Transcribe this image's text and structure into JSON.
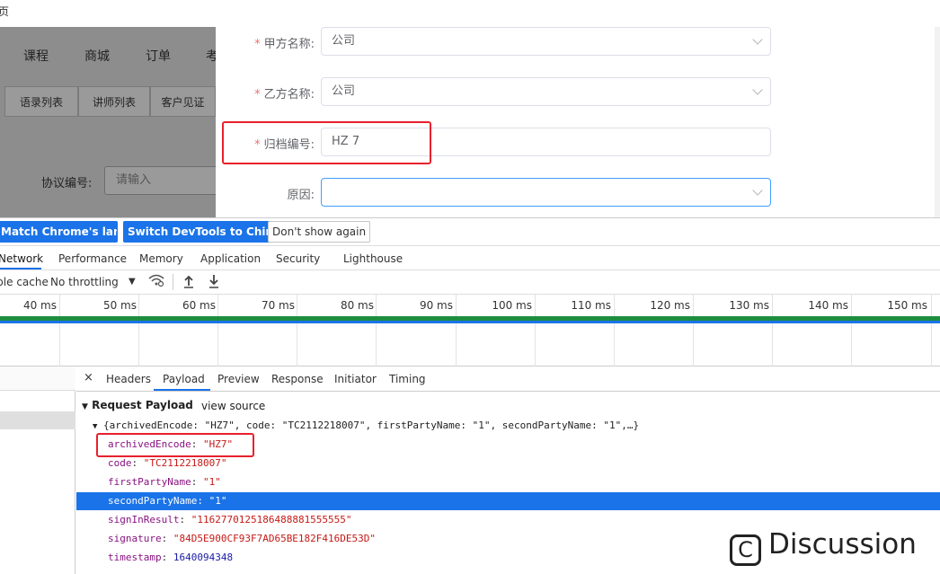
{
  "window": {
    "title_fragment": "页"
  },
  "app": {
    "nav": [
      "课程",
      "商城",
      "订单",
      "考"
    ],
    "tabs": [
      "语录列表",
      "讲师列表",
      "客户见证"
    ],
    "search": {
      "label": "协议编号:",
      "placeholder": "请输入"
    }
  },
  "dialog": {
    "fields": [
      {
        "label": "甲方名称:",
        "required": true,
        "value": "公司"
      },
      {
        "label": "乙方名称:",
        "required": true,
        "value": "公司"
      },
      {
        "label": "归档编号:",
        "required": true,
        "value": "HZ 7"
      },
      {
        "label": "原因:",
        "required": false,
        "value": ""
      }
    ],
    "required_mark": "*"
  },
  "devtools": {
    "infobar": {
      "match_language": "Match Chrome's language",
      "switch_chinese": "Switch DevTools to Chinese",
      "dont_show": "Don't show again"
    },
    "panels": [
      "Network",
      "Performance",
      "Memory",
      "Application",
      "Security",
      "Lighthouse"
    ],
    "active_panel": "Network",
    "toolbar": {
      "cache": "Disable cache",
      "throttling": "No throttling",
      "dropdown": "▼"
    },
    "timeline_ticks": [
      "40 ms",
      "50 ms",
      "60 ms",
      "70 ms",
      "80 ms",
      "90 ms",
      "100 ms",
      "110 ms",
      "120 ms",
      "130 ms",
      "140 ms",
      "150 ms"
    ],
    "detail_tabs": [
      "Headers",
      "Payload",
      "Preview",
      "Response",
      "Initiator",
      "Timing"
    ],
    "active_detail_tab": "Payload",
    "close": "×",
    "payload": {
      "title": "Request Payload",
      "view_source": "view source",
      "summary": "{archivedEncode: \"HZ7\", code: \"TC2112218007\", firstPartyName: \"1\", secondPartyName: \"1\",…}",
      "rows": [
        {
          "key": "archivedEncode",
          "value": "\"HZ7\"",
          "type": "string"
        },
        {
          "key": "code",
          "value": "\"TC2112218007\"",
          "type": "string"
        },
        {
          "key": "firstPartyName",
          "value": "\"1\"",
          "type": "string"
        },
        {
          "key": "secondPartyName",
          "value": "\"1\"",
          "type": "string"
        },
        {
          "key": "signInResult",
          "value": "\"1162770125186488881555555\"",
          "type": "string"
        },
        {
          "key": "signature",
          "value": "\"84D5E900CF93F7AD65BE182F416DE53D\"",
          "type": "string"
        },
        {
          "key": "timestamp",
          "value": "1640094348",
          "type": "number"
        }
      ]
    }
  },
  "watermark": {
    "icon": "C",
    "text": "Discussion"
  },
  "colors": {
    "highlight": "#e8212d",
    "devtools_blue": "#1a73e8",
    "required": "#f56c6c"
  }
}
